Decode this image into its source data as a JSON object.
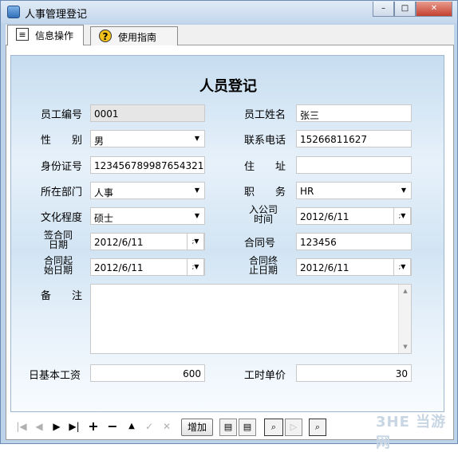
{
  "window": {
    "title": "人事管理登记",
    "minimize": "–",
    "maximize": "□",
    "close": "✕"
  },
  "tabs": [
    {
      "label": "信息操作",
      "icon": "book-icon",
      "active": true
    },
    {
      "label": "使用指南",
      "icon": "help-icon",
      "active": false
    }
  ],
  "form": {
    "title": "人员登记",
    "emp_no": {
      "label": "员工编号",
      "value": "0001"
    },
    "emp_name": {
      "label": "员工姓名",
      "value": "张三"
    },
    "gender": {
      "label": "性　　别",
      "value": "男"
    },
    "phone": {
      "label": "联系电话",
      "value": "15266811627"
    },
    "id_no": {
      "label": "身份证号",
      "value": "123456789987654321"
    },
    "address": {
      "label": "住　　址",
      "value": ""
    },
    "dept": {
      "label": "所在部门",
      "value": "人事"
    },
    "position": {
      "label": "职　　务",
      "value": "HR"
    },
    "education": {
      "label": "文化程度",
      "value": "硕士"
    },
    "join_date": {
      "label_line1": "入公司",
      "label_line2": "时间",
      "value": "2012/6/11"
    },
    "sign_date": {
      "label_line1": "签合同",
      "label_line2": "日期",
      "value": "2012/6/11"
    },
    "contract_no": {
      "label": "合同号",
      "value": "123456"
    },
    "start_date": {
      "label_line1": "合同起",
      "label_line2": "始日期",
      "value": "2012/6/11"
    },
    "end_date": {
      "label_line1": "合同终",
      "label_line2": "止日期",
      "value": "2012/6/11"
    },
    "remark": {
      "label": "备　　注",
      "value": ""
    },
    "daily_wage": {
      "label": "日基本工资",
      "value": "600"
    },
    "hourly_price": {
      "label": "工时单价",
      "value": "30"
    }
  },
  "toolbar": {
    "first": "|◀",
    "prev": "◀",
    "next": "▶",
    "last": "▶|",
    "add": "+",
    "delete": "−",
    "post": "▲",
    "edit": "✓",
    "cancel": "✕",
    "add_label": "增加"
  },
  "watermark": "3HE 当游网"
}
